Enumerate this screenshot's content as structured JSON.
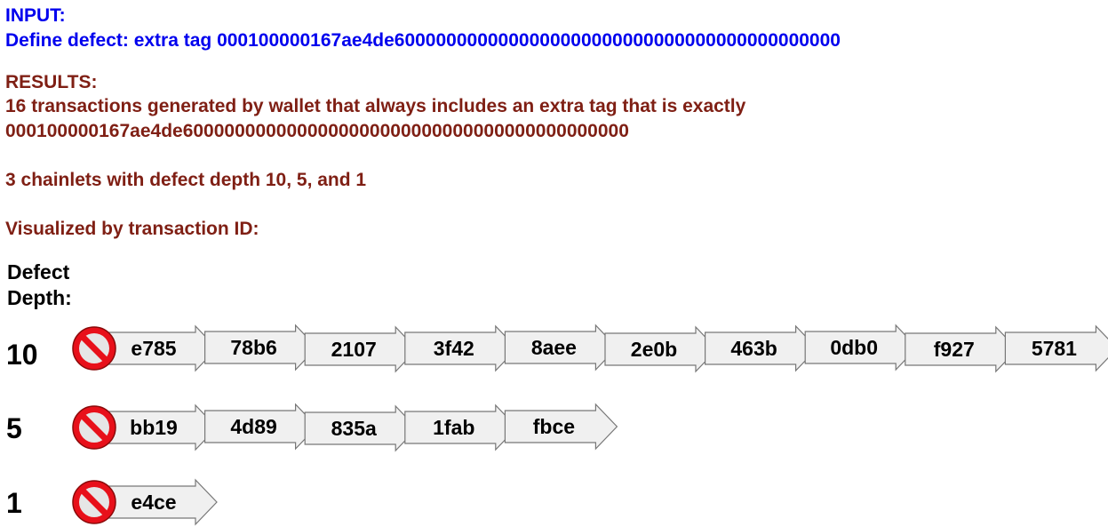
{
  "input": {
    "heading": "INPUT:",
    "definition": "Define defect: extra tag 000100000167ae4de6000000000000000000000000000000000000000000"
  },
  "results": {
    "heading": "RESULTS:",
    "line1": "16 transactions generated by wallet that always includes an extra tag that is exactly",
    "line2": "000100000167ae4de6000000000000000000000000000000000000000000",
    "chainlets": "3 chainlets with defect depth 10, 5, and 1",
    "visualized": "Visualized by transaction ID:"
  },
  "depth_header": [
    "Defect",
    "Depth:"
  ],
  "colors": {
    "input_text": "#0000ee",
    "results_text": "#7f1f14",
    "defect_icon": "#e8101a",
    "arrow_fill": "#f0f0f0",
    "arrow_stroke": "#777777"
  },
  "defect_icon": "no-entry-icon",
  "chainlets": [
    {
      "depth": "10",
      "transactions": [
        "e785",
        "78b6",
        "2107",
        "3f42",
        "8aee",
        "2e0b",
        "463b",
        "0db0",
        "f927",
        "5781"
      ]
    },
    {
      "depth": "5",
      "transactions": [
        "bb19",
        "4d89",
        "835a",
        "1fab",
        "fbce"
      ]
    },
    {
      "depth": "1",
      "transactions": [
        "e4ce"
      ]
    }
  ]
}
